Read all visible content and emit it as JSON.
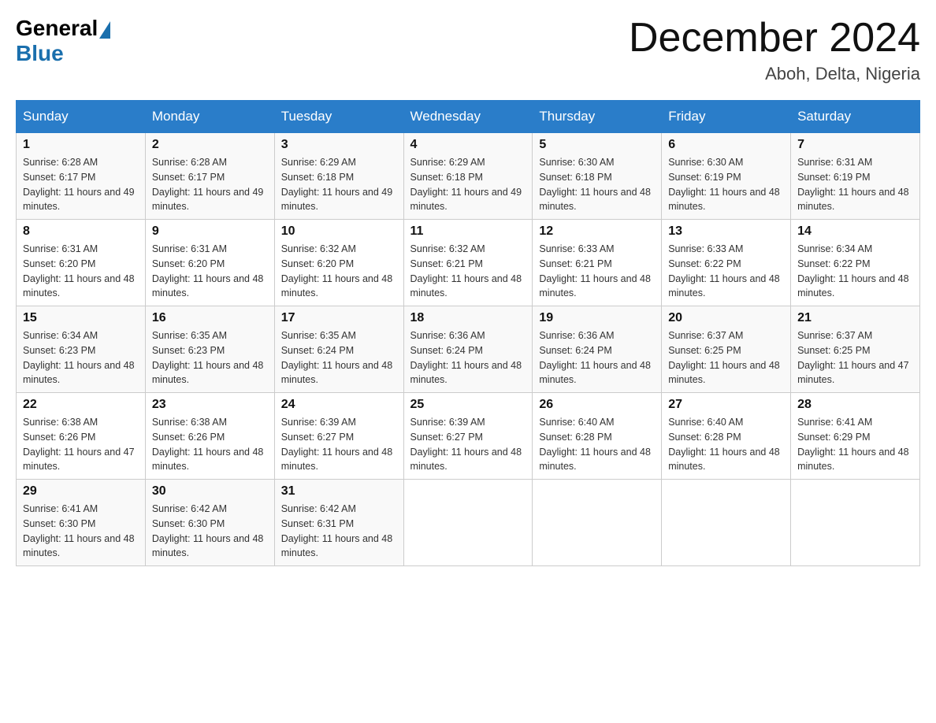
{
  "header": {
    "logo_general": "General",
    "logo_blue": "Blue",
    "month_title": "December 2024",
    "location": "Aboh, Delta, Nigeria"
  },
  "days_of_week": [
    "Sunday",
    "Monday",
    "Tuesday",
    "Wednesday",
    "Thursday",
    "Friday",
    "Saturday"
  ],
  "weeks": [
    [
      {
        "day": "1",
        "sunrise": "6:28 AM",
        "sunset": "6:17 PM",
        "daylight": "11 hours and 49 minutes."
      },
      {
        "day": "2",
        "sunrise": "6:28 AM",
        "sunset": "6:17 PM",
        "daylight": "11 hours and 49 minutes."
      },
      {
        "day": "3",
        "sunrise": "6:29 AM",
        "sunset": "6:18 PM",
        "daylight": "11 hours and 49 minutes."
      },
      {
        "day": "4",
        "sunrise": "6:29 AM",
        "sunset": "6:18 PM",
        "daylight": "11 hours and 49 minutes."
      },
      {
        "day": "5",
        "sunrise": "6:30 AM",
        "sunset": "6:18 PM",
        "daylight": "11 hours and 48 minutes."
      },
      {
        "day": "6",
        "sunrise": "6:30 AM",
        "sunset": "6:19 PM",
        "daylight": "11 hours and 48 minutes."
      },
      {
        "day": "7",
        "sunrise": "6:31 AM",
        "sunset": "6:19 PM",
        "daylight": "11 hours and 48 minutes."
      }
    ],
    [
      {
        "day": "8",
        "sunrise": "6:31 AM",
        "sunset": "6:20 PM",
        "daylight": "11 hours and 48 minutes."
      },
      {
        "day": "9",
        "sunrise": "6:31 AM",
        "sunset": "6:20 PM",
        "daylight": "11 hours and 48 minutes."
      },
      {
        "day": "10",
        "sunrise": "6:32 AM",
        "sunset": "6:20 PM",
        "daylight": "11 hours and 48 minutes."
      },
      {
        "day": "11",
        "sunrise": "6:32 AM",
        "sunset": "6:21 PM",
        "daylight": "11 hours and 48 minutes."
      },
      {
        "day": "12",
        "sunrise": "6:33 AM",
        "sunset": "6:21 PM",
        "daylight": "11 hours and 48 minutes."
      },
      {
        "day": "13",
        "sunrise": "6:33 AM",
        "sunset": "6:22 PM",
        "daylight": "11 hours and 48 minutes."
      },
      {
        "day": "14",
        "sunrise": "6:34 AM",
        "sunset": "6:22 PM",
        "daylight": "11 hours and 48 minutes."
      }
    ],
    [
      {
        "day": "15",
        "sunrise": "6:34 AM",
        "sunset": "6:23 PM",
        "daylight": "11 hours and 48 minutes."
      },
      {
        "day": "16",
        "sunrise": "6:35 AM",
        "sunset": "6:23 PM",
        "daylight": "11 hours and 48 minutes."
      },
      {
        "day": "17",
        "sunrise": "6:35 AM",
        "sunset": "6:24 PM",
        "daylight": "11 hours and 48 minutes."
      },
      {
        "day": "18",
        "sunrise": "6:36 AM",
        "sunset": "6:24 PM",
        "daylight": "11 hours and 48 minutes."
      },
      {
        "day": "19",
        "sunrise": "6:36 AM",
        "sunset": "6:24 PM",
        "daylight": "11 hours and 48 minutes."
      },
      {
        "day": "20",
        "sunrise": "6:37 AM",
        "sunset": "6:25 PM",
        "daylight": "11 hours and 48 minutes."
      },
      {
        "day": "21",
        "sunrise": "6:37 AM",
        "sunset": "6:25 PM",
        "daylight": "11 hours and 47 minutes."
      }
    ],
    [
      {
        "day": "22",
        "sunrise": "6:38 AM",
        "sunset": "6:26 PM",
        "daylight": "11 hours and 47 minutes."
      },
      {
        "day": "23",
        "sunrise": "6:38 AM",
        "sunset": "6:26 PM",
        "daylight": "11 hours and 48 minutes."
      },
      {
        "day": "24",
        "sunrise": "6:39 AM",
        "sunset": "6:27 PM",
        "daylight": "11 hours and 48 minutes."
      },
      {
        "day": "25",
        "sunrise": "6:39 AM",
        "sunset": "6:27 PM",
        "daylight": "11 hours and 48 minutes."
      },
      {
        "day": "26",
        "sunrise": "6:40 AM",
        "sunset": "6:28 PM",
        "daylight": "11 hours and 48 minutes."
      },
      {
        "day": "27",
        "sunrise": "6:40 AM",
        "sunset": "6:28 PM",
        "daylight": "11 hours and 48 minutes."
      },
      {
        "day": "28",
        "sunrise": "6:41 AM",
        "sunset": "6:29 PM",
        "daylight": "11 hours and 48 minutes."
      }
    ],
    [
      {
        "day": "29",
        "sunrise": "6:41 AM",
        "sunset": "6:30 PM",
        "daylight": "11 hours and 48 minutes."
      },
      {
        "day": "30",
        "sunrise": "6:42 AM",
        "sunset": "6:30 PM",
        "daylight": "11 hours and 48 minutes."
      },
      {
        "day": "31",
        "sunrise": "6:42 AM",
        "sunset": "6:31 PM",
        "daylight": "11 hours and 48 minutes."
      },
      null,
      null,
      null,
      null
    ]
  ]
}
